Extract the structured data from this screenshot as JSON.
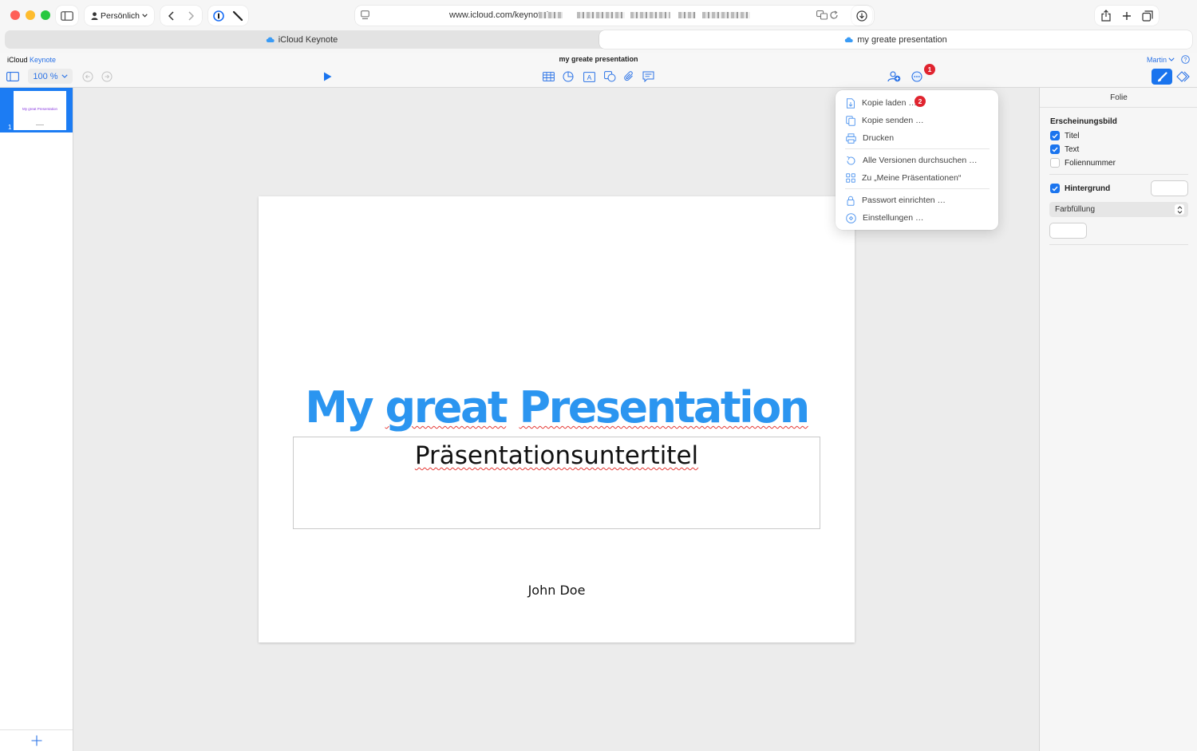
{
  "browser": {
    "profile_label": "Persönlich",
    "url_text": "www.icloud.com/keynote/",
    "tabs": [
      {
        "label": "iCloud Keynote",
        "active": false
      },
      {
        "label": "my greate presentation",
        "active": true
      }
    ]
  },
  "app": {
    "brand_prefix": "iCloud",
    "brand_app": "Keynote",
    "document_title": "my greate presentation",
    "user_name": "Martin",
    "zoom_label": "100 %",
    "accent_color": "#1a74ee"
  },
  "toolbar": {
    "left_icons": [
      "sidebar-toggle-icon",
      "undo-icon",
      "redo-icon"
    ],
    "play_icon": "play-icon",
    "insert_icons": [
      "table-icon",
      "chart-icon",
      "text-box-icon",
      "shape-icon",
      "media-icon",
      "comment-icon"
    ],
    "right_icons": [
      "collaborate-icon",
      "more-options-icon",
      "format-brush-icon",
      "animate-icon"
    ]
  },
  "navigator": {
    "slides": [
      {
        "number": "1",
        "thumb_title": "My great Presentation"
      }
    ]
  },
  "slide": {
    "title_words": [
      "My",
      "great",
      "Presentation"
    ],
    "subtitle": "Präsentationsuntertitel",
    "author": "John Doe"
  },
  "inspector": {
    "tab_label": "Folie",
    "appearance_heading": "Erscheinungsbild",
    "options": [
      {
        "label": "Titel",
        "checked": true
      },
      {
        "label": "Text",
        "checked": true
      },
      {
        "label": "Foliennummer",
        "checked": false
      }
    ],
    "background_label": "Hintergrund",
    "background_checked": true,
    "fill_select_value": "Farbfüllung"
  },
  "menu": {
    "groups": [
      [
        {
          "label": "Kopie laden …",
          "icon": "download-copy-icon"
        },
        {
          "label": "Kopie senden …",
          "icon": "send-copy-icon"
        },
        {
          "label": "Drucken",
          "icon": "print-icon"
        }
      ],
      [
        {
          "label": "Alle Versionen durchsuchen …",
          "icon": "versions-icon"
        },
        {
          "label": "Zu „Meine Präsentationen“",
          "icon": "grid-icon"
        }
      ],
      [
        {
          "label": "Passwort einrichten …",
          "icon": "lock-icon"
        },
        {
          "label": "Einstellungen …",
          "icon": "settings-icon"
        }
      ]
    ]
  },
  "annotations": {
    "badge_1": "1",
    "badge_2": "2",
    "badge_color": "#e0242f"
  }
}
